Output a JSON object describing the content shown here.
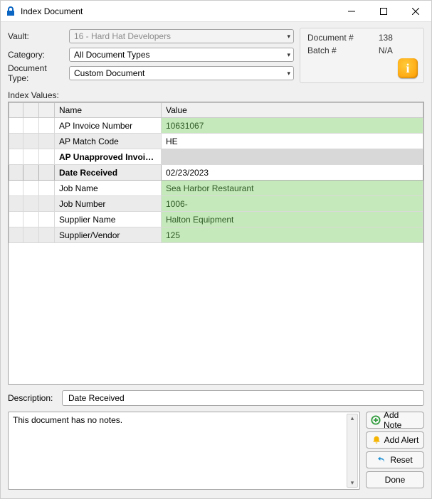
{
  "window": {
    "title": "Index Document"
  },
  "form": {
    "vault_label": "Vault:",
    "vault_value": "16 - Hard Hat Developers",
    "category_label": "Category:",
    "category_value": "All Document Types",
    "doctype_label": "Document Type:",
    "doctype_value": "Custom Document"
  },
  "info": {
    "docnum_label": "Document #",
    "docnum_value": "138",
    "batch_label": "Batch #",
    "batch_value": "N/A"
  },
  "index_values_label": "Index Values:",
  "grid": {
    "headers": {
      "c0": "",
      "c1": "",
      "c2": "",
      "name": "Name",
      "value": "Value"
    },
    "rows": [
      {
        "name": "AP Invoice Number",
        "value": "10631067",
        "alt": false,
        "green": true,
        "bold": false
      },
      {
        "name": "AP Match Code",
        "value": "HE",
        "alt": true,
        "green": false,
        "bold": false
      },
      {
        "name": "AP Unapproved Invoice...",
        "value": "",
        "alt": false,
        "green": false,
        "bold": true,
        "gray": true
      },
      {
        "name": "Date Received",
        "value": "02/23/2023",
        "alt": true,
        "green": false,
        "bold": true,
        "editing": true
      },
      {
        "name": "Job Name",
        "value": "Sea Harbor Restaurant",
        "alt": false,
        "green": true,
        "bold": false
      },
      {
        "name": "Job Number",
        "value": " 1006-",
        "alt": true,
        "green": true,
        "bold": false
      },
      {
        "name": "Supplier Name",
        "value": "Halton Equipment",
        "alt": false,
        "green": true,
        "bold": false
      },
      {
        "name": "Supplier/Vendor",
        "value": "125",
        "alt": true,
        "green": true,
        "bold": false
      }
    ]
  },
  "description": {
    "label": "Description:",
    "value": "Date Received"
  },
  "notes": {
    "text": "This document has no notes."
  },
  "buttons": {
    "add_note": "Add Note",
    "add_alert": "Add Alert",
    "reset": "Reset",
    "done": "Done"
  }
}
